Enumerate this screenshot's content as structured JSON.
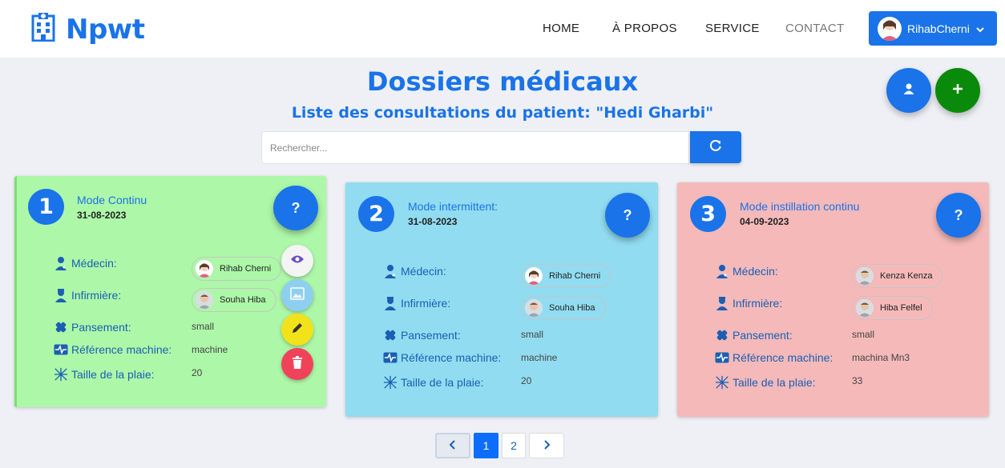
{
  "brand": {
    "name": "Npwt",
    "icon": "hospital-icon"
  },
  "nav": {
    "home": "HOME",
    "about": "À PROPOS",
    "service": "SERVICE",
    "contact": "CONTACT",
    "user": "RihabCherni"
  },
  "header": {
    "title": "Dossiers médicaux",
    "subtitle": "Liste des consultations du patient: \"Hedi Gharbi\""
  },
  "search": {
    "placeholder": "Rechercher..."
  },
  "labels": {
    "medecin": "Médecin:",
    "infirmiere": "Infirmière:",
    "pansement": "Pansement:",
    "reference": "Référence machine:",
    "taille": "Taille de la plaie:"
  },
  "cards": [
    {
      "number": "1",
      "mode": "Mode Continu",
      "date": "31-08-2023",
      "help": "?",
      "medecin": "Rihab Cherni",
      "infirmiere": "Souha Hiba",
      "pansement": "small",
      "reference": "machine",
      "taille": "20",
      "color": "#adf7a8"
    },
    {
      "number": "2",
      "mode": "Mode intermittent:",
      "date": "31-08-2023",
      "help": "?",
      "medecin": "Rihab Cherni",
      "infirmiere": "Souha Hiba",
      "pansement": "small",
      "reference": "machine",
      "taille": "20",
      "color": "#91dcf0"
    },
    {
      "number": "3",
      "mode": "Mode instillation continu",
      "date": "04-09-2023",
      "help": "?",
      "medecin": "Kenza Kenza",
      "infirmiere": "Hiba Felfel",
      "pansement": "small",
      "reference": "machina Mn3",
      "taille": "33",
      "color": "#f5b9b9"
    }
  ],
  "pagination": {
    "page1": "1",
    "page2": "2",
    "current": 1
  },
  "colors": {
    "primary": "#1a73e8",
    "success": "#0a8a0a",
    "warning": "#f2e21a",
    "danger": "#f0435a",
    "info": "#8ecff0"
  }
}
